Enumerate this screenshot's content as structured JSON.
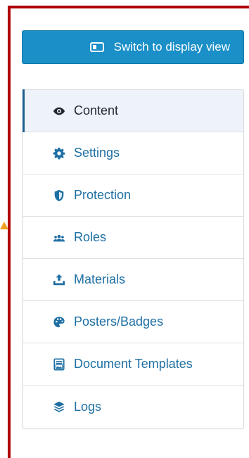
{
  "switch_button": {
    "label": "Switch to display view",
    "icon": "display-toggle-icon"
  },
  "nav": {
    "active_item": "Content",
    "items": [
      {
        "label": "Content",
        "icon": "eye-icon"
      },
      {
        "label": "Settings",
        "icon": "gear-icon"
      },
      {
        "label": "Protection",
        "icon": "shield-icon"
      },
      {
        "label": "Roles",
        "icon": "users-icon"
      },
      {
        "label": "Materials",
        "icon": "upload-tray-icon"
      },
      {
        "label": "Posters/Badges",
        "icon": "palette-icon"
      },
      {
        "label": "Document Templates",
        "icon": "document-image-icon"
      },
      {
        "label": "Logs",
        "icon": "layers-icon"
      }
    ]
  },
  "colors": {
    "accent_button": "#1a8fc8",
    "link_text": "#1e6fa3",
    "active_bg": "#eef3f9",
    "frame_border": "#b00000",
    "marker": "#f0a020"
  }
}
